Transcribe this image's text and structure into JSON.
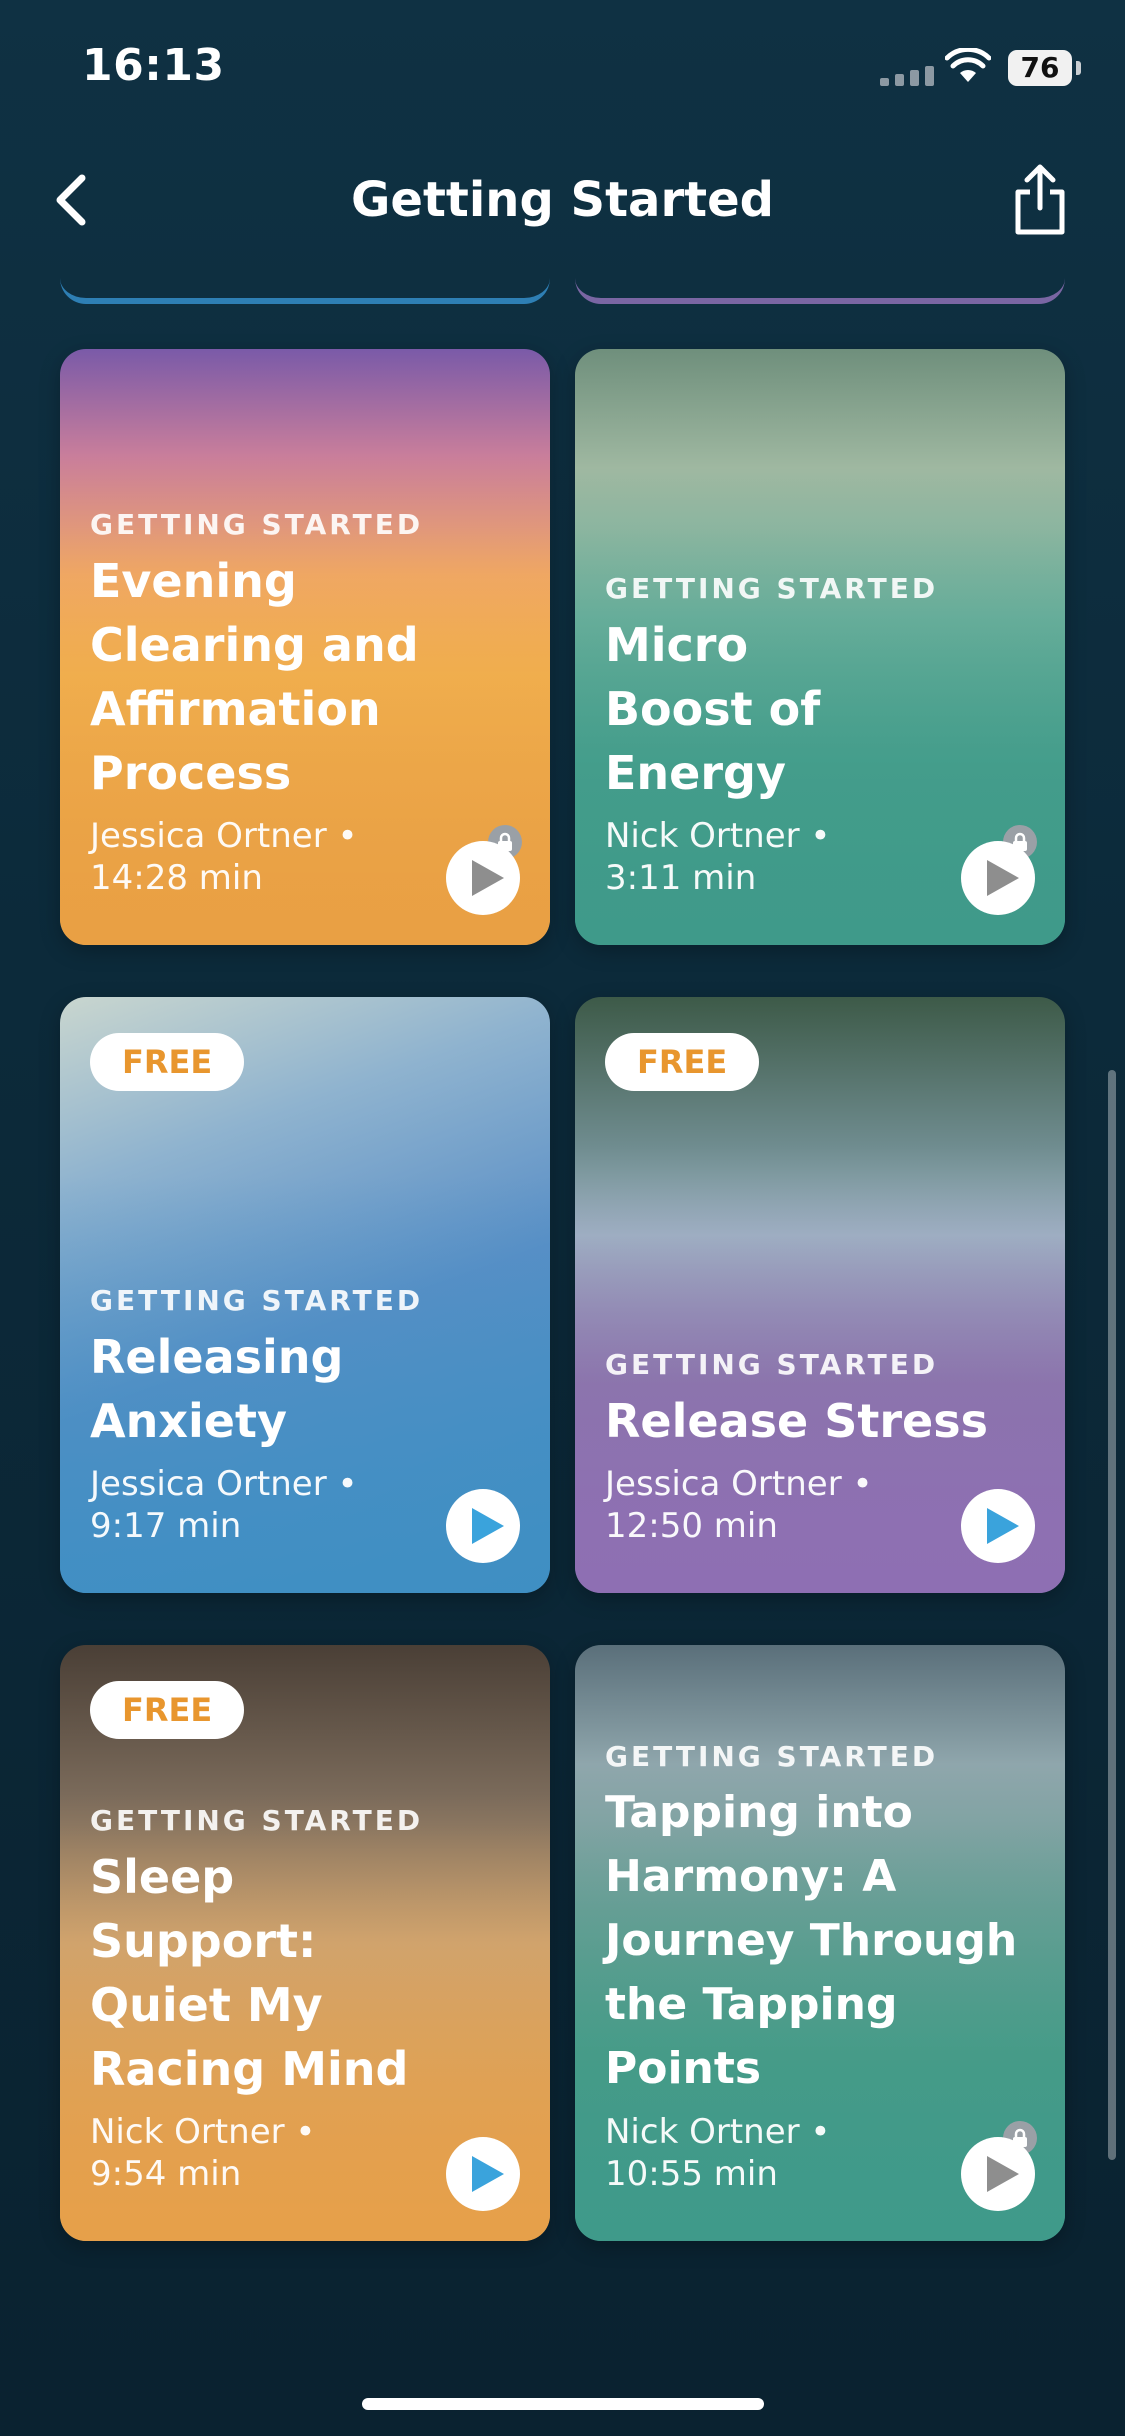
{
  "status_bar": {
    "time": "16:13",
    "battery": "76"
  },
  "nav": {
    "title": "Getting Started",
    "back_icon": "chevron-left-icon",
    "share_icon": "share-icon"
  },
  "cards": [
    {
      "category": "GETTING STARTED",
      "title": "Evening Clearing and Affirmation Process",
      "author": "Jessica Ortner •",
      "duration": "14:28 min",
      "locked": true,
      "free": false,
      "accent": "#e9a044"
    },
    {
      "category": "GETTING STARTED",
      "title": "Micro Boost of Energy",
      "author": "Nick Ortner •",
      "duration": "3:11 min",
      "locked": true,
      "free": false,
      "accent": "#3f9a8a"
    },
    {
      "category": "GETTING STARTED",
      "title": "Releasing Anxiety",
      "author": "Jessica Ortner •",
      "duration": "9:17 min",
      "locked": false,
      "free": true,
      "free_label": "FREE",
      "accent": "#3f8fc3"
    },
    {
      "category": "GETTING STARTED",
      "title": "Release Stress",
      "author": "Jessica Ortner •",
      "duration": "12:50 min",
      "locked": false,
      "free": true,
      "free_label": "FREE",
      "accent": "#8e6fb3"
    },
    {
      "category": "GETTING STARTED",
      "title": "Sleep Support: Quiet My Racing Mind",
      "author": "Nick Ortner •",
      "duration": "9:54 min",
      "locked": false,
      "free": true,
      "free_label": "FREE",
      "accent": "#e6a04a"
    },
    {
      "category": "GETTING STARTED",
      "title": "Tapping into Harmony: A Journey Through the Tapping Points",
      "author": "Nick Ortner •",
      "duration": "10:55 min",
      "locked": true,
      "free": false,
      "accent": "#3f9a8a"
    }
  ],
  "colors": {
    "play_icon": "#3aa3dc",
    "play_icon_locked": "#8e8e8e",
    "free_text": "#e8962e"
  }
}
